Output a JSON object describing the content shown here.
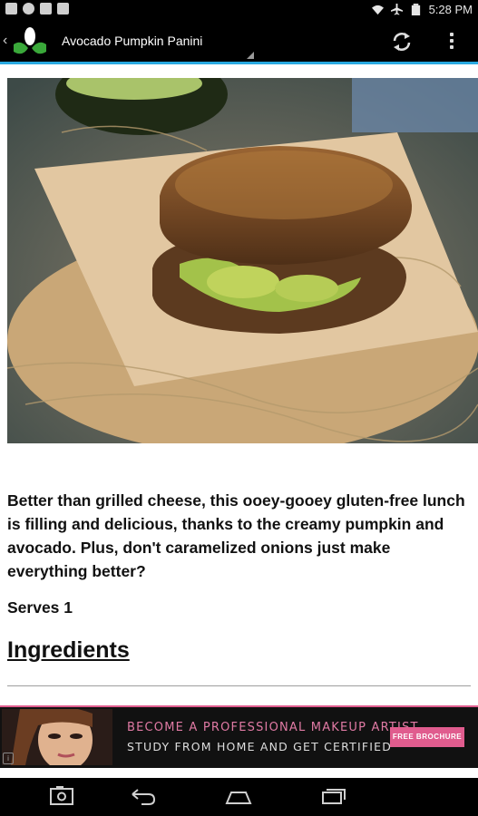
{
  "status_bar": {
    "time": "5:28 PM",
    "left_icons": [
      "gallery-icon",
      "notification-icon",
      "gmail-icon",
      "download-icon"
    ],
    "right_icons": [
      "wifi-icon",
      "airplane-icon",
      "battery-icon"
    ]
  },
  "app_bar": {
    "title": "Avocado Pumpkin Panini",
    "logo_color": "#3aa83a",
    "accent_line": "#29a9e0",
    "actions": [
      "refresh-icon",
      "overflow-menu-icon"
    ]
  },
  "content": {
    "description": "Better than grilled cheese, this ooey-gooey gluten-free lunch is filling and delicious, thanks to the creamy pumpkin and avocado. Plus, don't caramelized onions just make everything better?",
    "serves": "Serves 1",
    "section_heading": "Ingredients"
  },
  "ad": {
    "line1": "BECOME A PROFESSIONAL MAKEUP ARTIST",
    "line2": "STUDY FROM HOME AND GET CERTIFIED",
    "button": "FREE BROCHURE",
    "badge": "i",
    "accent_color": "#e05c8e"
  },
  "nav_bar": {
    "buttons": [
      "recent-apps-screenshot-icon",
      "back-icon",
      "home-icon",
      "recents-icon"
    ]
  }
}
